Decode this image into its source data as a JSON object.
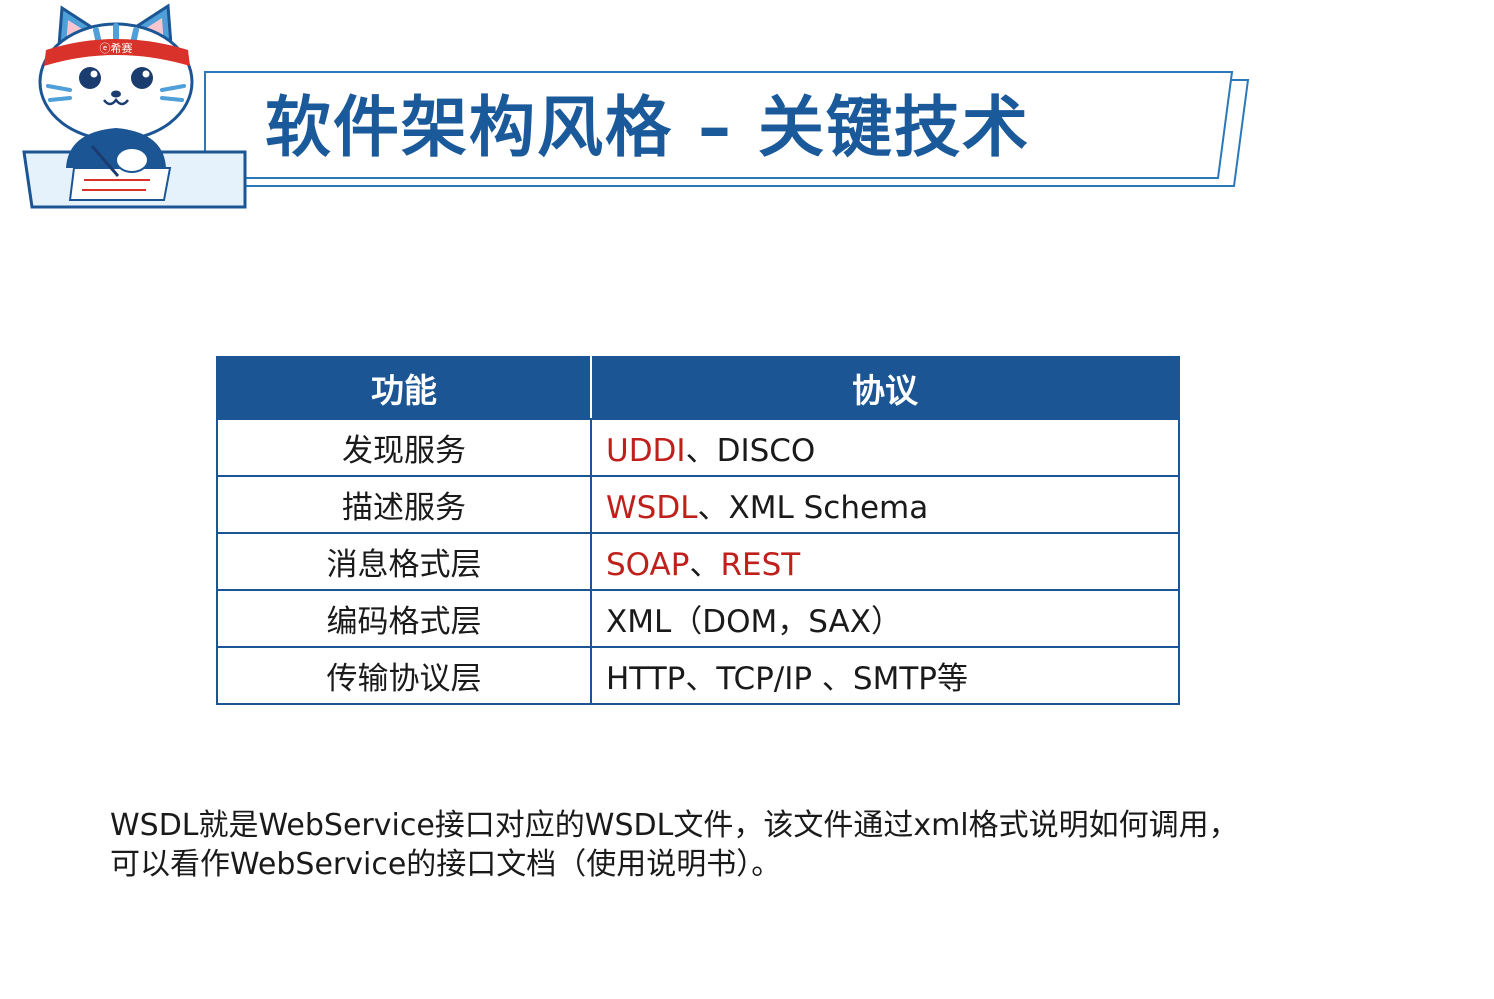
{
  "header": {
    "title": "软件架构风格 – 关键技术",
    "mascot_headband_text": "希赛"
  },
  "table": {
    "columns": [
      "功能",
      "协议"
    ],
    "rows": [
      {
        "function": "发现服务",
        "protocol": [
          {
            "text": "UDDI",
            "highlight": true
          },
          {
            "text": "、DISCO",
            "highlight": false
          }
        ]
      },
      {
        "function": "描述服务",
        "protocol": [
          {
            "text": "WSDL",
            "highlight": true
          },
          {
            "text": "、XML Schema",
            "highlight": false
          }
        ]
      },
      {
        "function": "消息格式层",
        "protocol": [
          {
            "text": "SOAP",
            "highlight": true
          },
          {
            "text": "、",
            "highlight": false
          },
          {
            "text": "REST",
            "highlight": true
          }
        ]
      },
      {
        "function": "编码格式层",
        "protocol": [
          {
            "text": "XML（DOM，SAX）",
            "highlight": false
          }
        ]
      },
      {
        "function": "传输协议层",
        "protocol": [
          {
            "text": "HTTP、TCP/IP 、SMTP等",
            "highlight": false
          }
        ]
      }
    ]
  },
  "note": {
    "line1": "WSDL就是WebService接口对应的WSDL文件，该文件通过xml格式说明如何调用，",
    "line2": "可以看作WebService的接口文档（使用说明书）。"
  },
  "colors": {
    "brand_blue": "#1b5594",
    "title_blue": "#1b5a9a",
    "highlight_red": "#c0201c"
  }
}
